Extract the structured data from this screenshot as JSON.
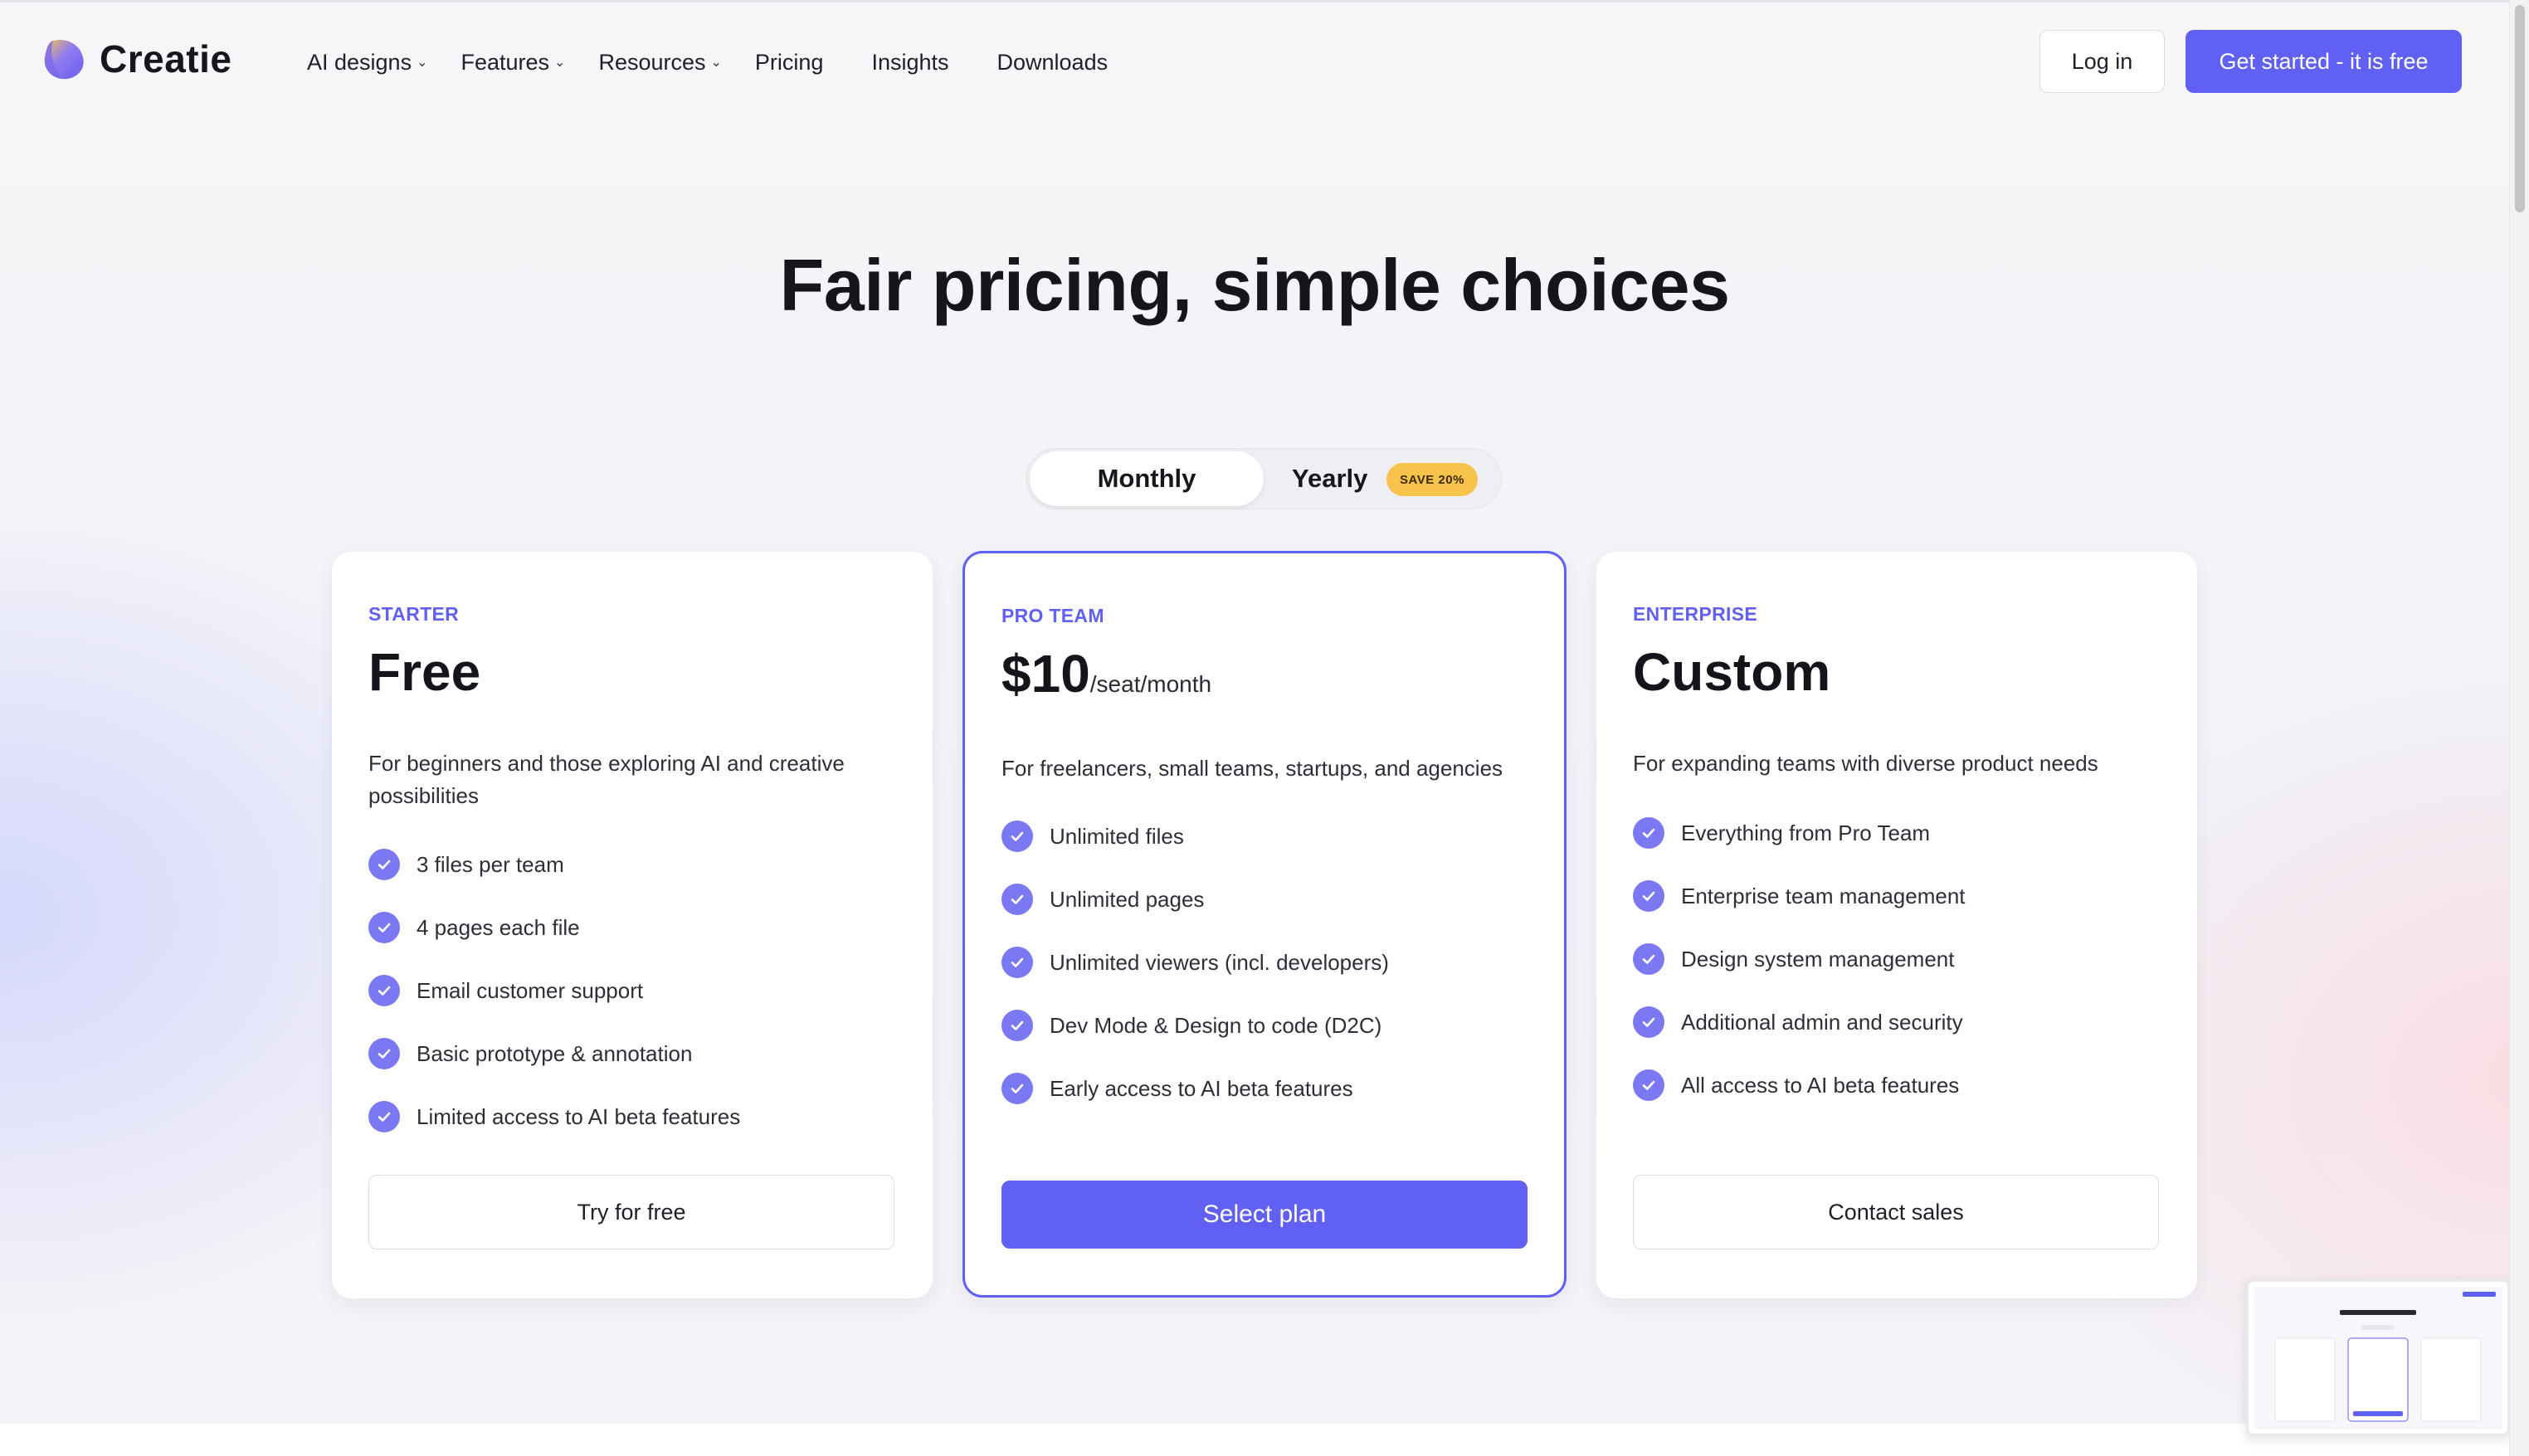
{
  "brand": {
    "name": "Creatie"
  },
  "nav": {
    "items": [
      {
        "label": "AI designs",
        "dropdown": true
      },
      {
        "label": "Features",
        "dropdown": true
      },
      {
        "label": "Resources",
        "dropdown": true
      },
      {
        "label": "Pricing",
        "dropdown": false
      },
      {
        "label": "Insights",
        "dropdown": false
      },
      {
        "label": "Downloads",
        "dropdown": false
      }
    ],
    "login_label": "Log in",
    "cta_label": "Get started - it is free"
  },
  "hero": {
    "title": "Fair pricing, simple choices"
  },
  "billing_toggle": {
    "monthly_label": "Monthly",
    "yearly_label": "Yearly",
    "save_badge": "SAVE 20%",
    "selected": "Monthly"
  },
  "plans": [
    {
      "tier": "STARTER",
      "price": "Free",
      "price_unit": "",
      "description": "For beginners and those exploring AI and creative possibilities",
      "features": [
        "3 files per team",
        "4 pages each file",
        "Email customer support",
        "Basic prototype & annotation",
        "Limited access to AI beta features"
      ],
      "button_label": "Try for free"
    },
    {
      "tier": "PRO TEAM",
      "price": "$10",
      "price_unit": "/seat/month",
      "description": "For freelancers, small teams, startups, and agencies",
      "features": [
        "Unlimited files",
        "Unlimited pages",
        "Unlimited viewers (incl. developers)",
        "Dev Mode & Design to code (D2C)",
        "Early access to AI beta features"
      ],
      "button_label": "Select plan"
    },
    {
      "tier": "ENTERPRISE",
      "price": "Custom",
      "price_unit": "",
      "description": "For expanding teams with diverse product needs",
      "features": [
        "Everything from Pro Team",
        "Enterprise team management",
        "Design system management",
        "Additional admin and security",
        "All access to AI beta features"
      ],
      "button_label": "Contact sales"
    }
  ],
  "colors": {
    "accent": "#6160f4",
    "check": "#7b78f4",
    "save_badge": "#f7c34a"
  }
}
